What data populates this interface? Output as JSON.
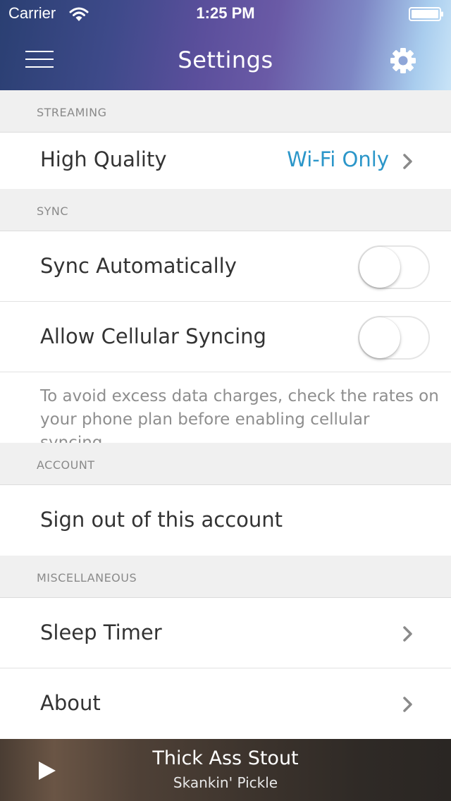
{
  "status_bar": {
    "carrier": "Carrier",
    "time": "1:25 PM",
    "wifi_icon": "wifi-icon",
    "battery_icon": "battery-icon"
  },
  "nav": {
    "title": "Settings",
    "menu_icon": "hamburger-menu-icon",
    "settings_icon": "gear-icon"
  },
  "sections": {
    "streaming": {
      "header": "STREAMING",
      "high_quality": {
        "label": "High Quality",
        "value": "Wi-Fi Only"
      }
    },
    "sync": {
      "header": "SYNC",
      "sync_automatically": {
        "label": "Sync Automatically",
        "on": false
      },
      "allow_cellular": {
        "label": "Allow Cellular Syncing",
        "on": false
      },
      "note": "To avoid excess data charges, check the rates on your phone plan before enabling cellular syncing."
    },
    "account": {
      "header": "ACCOUNT",
      "sign_out": {
        "label": "Sign out of this account"
      }
    },
    "misc": {
      "header": "MISCELLANEOUS",
      "sleep_timer": {
        "label": "Sleep Timer"
      },
      "about": {
        "label": "About"
      }
    }
  },
  "player": {
    "title": "Thick Ass Stout",
    "artist": "Skankin' Pickle",
    "play_icon": "play-icon"
  },
  "colors": {
    "accent": "#2b96c9",
    "chevron": "#8a8a8a",
    "section_bg": "#f0f0f0"
  }
}
